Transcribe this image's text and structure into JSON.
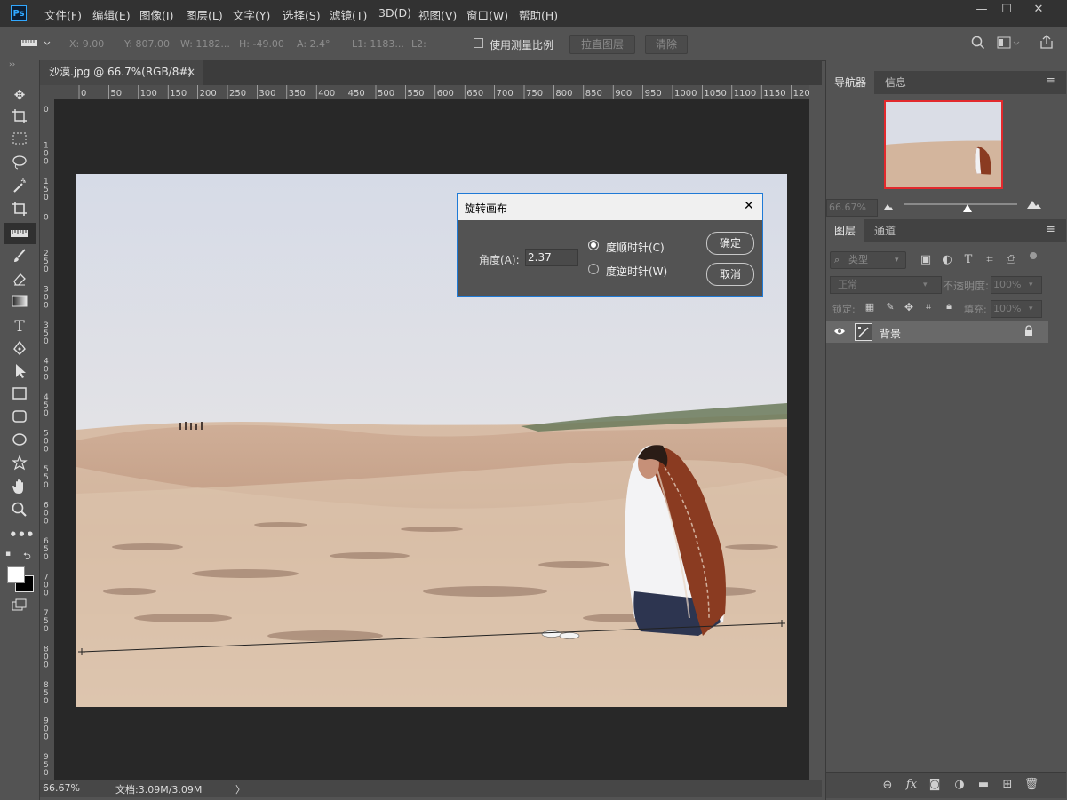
{
  "app": {
    "logo": "Ps"
  },
  "menu": [
    "文件(F)",
    "编辑(E)",
    "图像(I)",
    "图层(L)",
    "文字(Y)",
    "选择(S)",
    "滤镜(T)",
    "3D(D)",
    "视图(V)",
    "窗口(W)",
    "帮助(H)"
  ],
  "window_controls": {
    "minimize": "—",
    "maximize": "☐",
    "close": "✕"
  },
  "options_bar": {
    "x": "X: 9.00",
    "y": "Y: 807.00",
    "w": "W: 1182...",
    "h": "H: -49.00",
    "a": "A: 2.4°",
    "l1": "L1: 1183...",
    "l2": "L2:",
    "use_scale_label": "使用测量比例",
    "straighten_label": "拉直图层",
    "clear_label": "清除"
  },
  "document": {
    "tab_title": "沙漠.jpg @ 66.7%(RGB/8#)",
    "tab_close": "×",
    "zoom": "66.67%",
    "doc_size": "文档:3.09M/3.09M",
    "status_arrow": "〉"
  },
  "ruler": {
    "top": [
      "0",
      "50",
      "100",
      "150",
      "200",
      "250",
      "300",
      "350",
      "400",
      "450",
      "500",
      "550",
      "600",
      "650",
      "700",
      "750",
      "800",
      "850",
      "900",
      "950",
      "1000",
      "1050",
      "1100",
      "1150",
      "1200"
    ],
    "left": [
      "0",
      "100",
      "150",
      "0",
      "250",
      "300",
      "350",
      "400",
      "450",
      "500",
      "550",
      "600",
      "650",
      "700",
      "750",
      "800",
      "850",
      "900",
      "950"
    ]
  },
  "dialog": {
    "title": "旋转画布",
    "close": "✕",
    "angle_label": "角度(A):",
    "angle_value": "2.37",
    "cw_label": "度顺时针(C)",
    "ccw_label": "度逆时针(W)",
    "selected": "cw",
    "ok_label": "确定",
    "cancel_label": "取消"
  },
  "navigator": {
    "tabs": [
      "导航器",
      "信息"
    ],
    "zoom": "66.67%",
    "slider_position": 0.56
  },
  "layers": {
    "tabs": [
      "图层",
      "通道"
    ],
    "filter_placeholder": "类型",
    "blend_mode": "正常",
    "opacity_label": "不透明度:",
    "opacity_value": "100%",
    "lock_label": "锁定:",
    "fill_label": "填充:",
    "fill_value": "100%",
    "items": [
      {
        "name": "背景",
        "visible": true,
        "locked": true
      }
    ]
  },
  "colors": {
    "accent": "#1f7ad6",
    "nav_frame": "#e2292d"
  }
}
